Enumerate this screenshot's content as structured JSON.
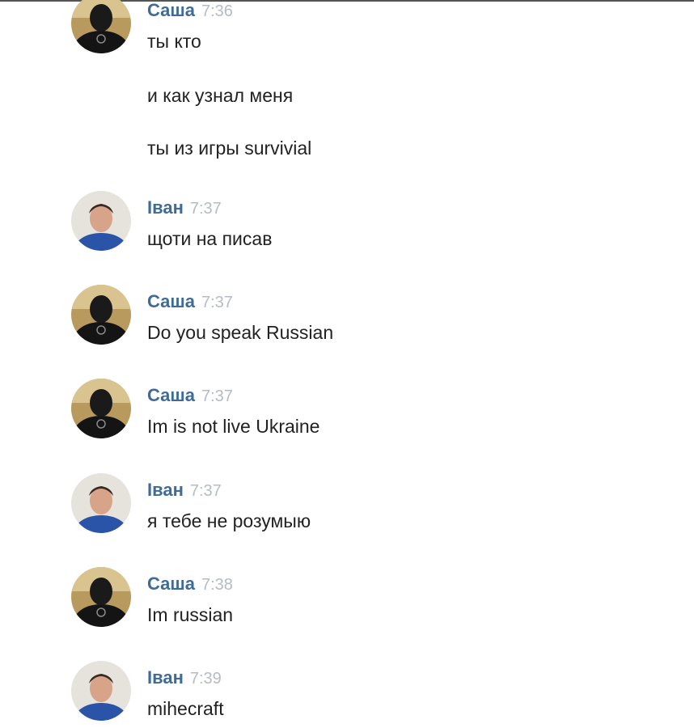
{
  "messages": [
    {
      "author": "Саша",
      "time": "7:36",
      "avatar": "sasha",
      "lines": [
        "ты кто",
        "и как узнал меня",
        "ты из игры survivial"
      ]
    },
    {
      "author": "Іван",
      "time": "7:37",
      "avatar": "ivan",
      "lines": [
        "щоти на писав"
      ]
    },
    {
      "author": "Саша",
      "time": "7:37",
      "avatar": "sasha",
      "lines": [
        "Do you speak Russian"
      ]
    },
    {
      "author": "Саша",
      "time": "7:37",
      "avatar": "sasha",
      "lines": [
        "Im is not live Ukraine"
      ]
    },
    {
      "author": "Іван",
      "time": "7:37",
      "avatar": "ivan",
      "lines": [
        "я тебе не розумыю"
      ]
    },
    {
      "author": "Саша",
      "time": "7:38",
      "avatar": "sasha",
      "lines": [
        "Im russian"
      ]
    },
    {
      "author": "Іван",
      "time": "7:39",
      "avatar": "ivan",
      "lines": [
        "mihecraft"
      ]
    }
  ],
  "colors": {
    "author": "#3f6b96",
    "time": "#b5bcc4",
    "text": "#222222",
    "background": "#ffffff"
  }
}
